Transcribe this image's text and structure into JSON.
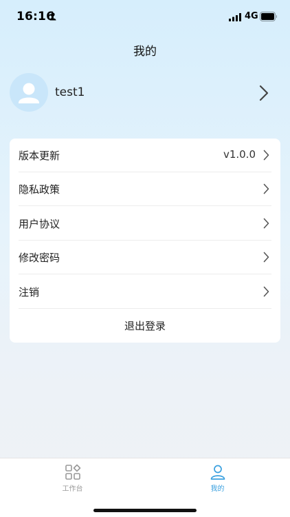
{
  "status_bar": {
    "time": "16:16",
    "network": "4G"
  },
  "header": {
    "title": "我的"
  },
  "profile": {
    "username": "test1"
  },
  "menu": {
    "items": [
      {
        "label": "版本更新",
        "value": "v1.0.0"
      },
      {
        "label": "隐私政策"
      },
      {
        "label": "用户协议"
      },
      {
        "label": "修改密码"
      },
      {
        "label": "注销"
      }
    ],
    "logout_label": "退出登录"
  },
  "tab_bar": {
    "tabs": [
      {
        "label": "工作台",
        "icon": "grid-icon",
        "active": false
      },
      {
        "label": "我的",
        "icon": "person-icon",
        "active": true
      }
    ],
    "active_color": "#3aa0df",
    "inactive_color": "#999999"
  }
}
